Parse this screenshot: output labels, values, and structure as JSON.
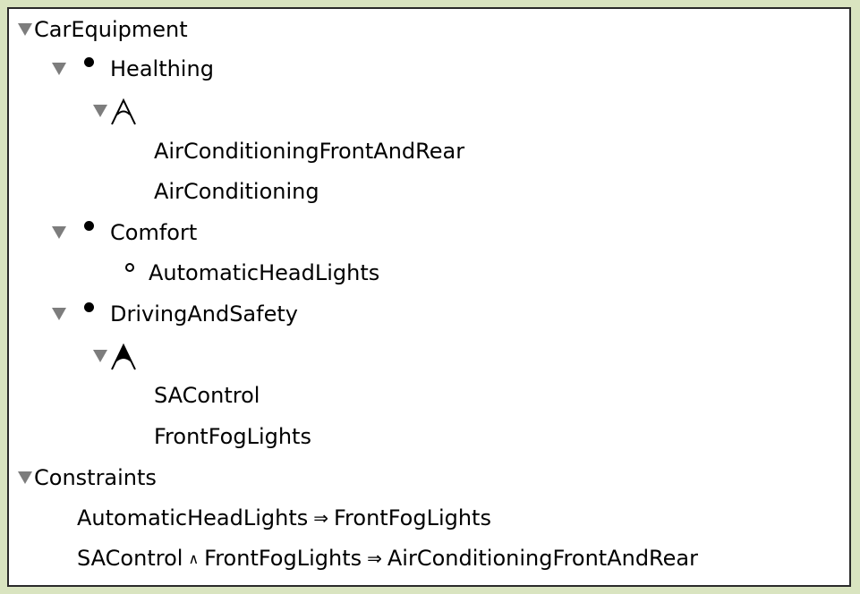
{
  "tree": {
    "root": "CarEquipment",
    "groups": [
      {
        "label": "Healthing",
        "type": "mandatory",
        "group_type": "or",
        "children": [
          "AirConditioningFrontAndRear",
          "AirConditioning"
        ]
      },
      {
        "label": "Comfort",
        "type": "mandatory",
        "children": [
          {
            "label": "AutomaticHeadLights",
            "type": "optional"
          }
        ]
      },
      {
        "label": "DrivingAndSafety",
        "type": "mandatory",
        "group_type": "alternative",
        "children": [
          "SAControl",
          "FrontFogLights"
        ]
      }
    ]
  },
  "constraints": {
    "title": "Constraints",
    "items": [
      {
        "left": "AutomaticHeadLights",
        "implies": "⇒",
        "right": "FrontFogLights"
      },
      {
        "left": "SAControl",
        "and": "∧",
        "middle": "FrontFogLights",
        "implies": "⇒",
        "right": "AirConditioningFrontAndRear"
      }
    ]
  },
  "colors": {
    "background": "#d9e4c0",
    "panel": "#ffffff",
    "disclosure_triangle": "#7d7d7d"
  }
}
